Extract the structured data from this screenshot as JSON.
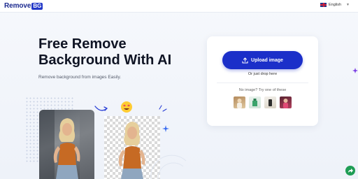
{
  "header": {
    "logo_text": "Remove",
    "logo_badge": "BG",
    "language": "English"
  },
  "hero": {
    "title_line1": "Free Remove",
    "title_line2": "Background With AI",
    "subtitle": "Remove background from images Easily."
  },
  "upload": {
    "button_label": "Upload image",
    "drop_text": "Or just drop here",
    "sample_prompt": "No image? Try one of these"
  },
  "colors": {
    "brand_blue": "#1b2fc9",
    "fab_green": "#1f9d55",
    "logo_navy": "#1b2a8f"
  },
  "icons": [
    "flag-uk-icon",
    "chevron-down-icon",
    "upload-icon",
    "share-icon",
    "sparkle-icon",
    "star-eyes-emoji-icon",
    "curved-arrow-icon"
  ]
}
